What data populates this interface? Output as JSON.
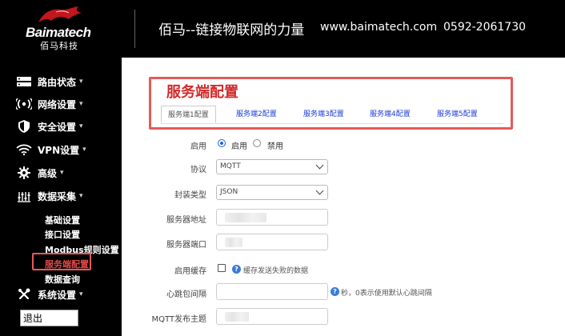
{
  "header": {
    "brand": "Baimatech",
    "brand_cn": "佰马科技",
    "slogan": "佰马--链接物联网的力量",
    "website": "www.baimatech.com",
    "phone": "0592-2061730"
  },
  "sidebar": {
    "items": [
      {
        "label": "路由状态",
        "icon": "server-icon"
      },
      {
        "label": "网络设置",
        "icon": "broadcast-icon"
      },
      {
        "label": "安全设置",
        "icon": "shield-icon"
      },
      {
        "label": "VPN设置",
        "icon": "wifi-icon"
      },
      {
        "label": "高级",
        "icon": "gear-icon"
      },
      {
        "label": "数据采集",
        "icon": "equalizer-icon"
      }
    ],
    "sub_items": [
      "基础设置",
      "接口设置",
      "Modbus规则设置",
      "服务端配置",
      "数据查询"
    ],
    "system": {
      "label": "系统设置",
      "icon": "tools-icon"
    },
    "logout": "退出"
  },
  "main": {
    "title": "服务端配置",
    "tabs": [
      "服务端1配置",
      "服务端2配置",
      "服务端3配置",
      "服务端4配置",
      "服务端5配置"
    ],
    "form": {
      "enable_label": "启用",
      "enable_on": "启用",
      "enable_off": "禁用",
      "protocol_label": "协议",
      "protocol_value": "MQTT",
      "encap_label": "封装类型",
      "encap_value": "JSON",
      "server_addr_label": "服务器地址",
      "server_port_label": "服务器端口",
      "cache_label": "启用缓存",
      "cache_hint": "缓存发送失败的数据",
      "heartbeat_label": "心跳包间隔",
      "heartbeat_hint": "秒，0表示使用默认心跳间隔",
      "mqtt_topic_label": "MQTT发布主题"
    }
  },
  "colors": {
    "accent_red": "#d12a2a",
    "highlight_border": "#e55a5a",
    "link_blue": "#1b3cd6",
    "radio_blue": "#1e63d6"
  }
}
